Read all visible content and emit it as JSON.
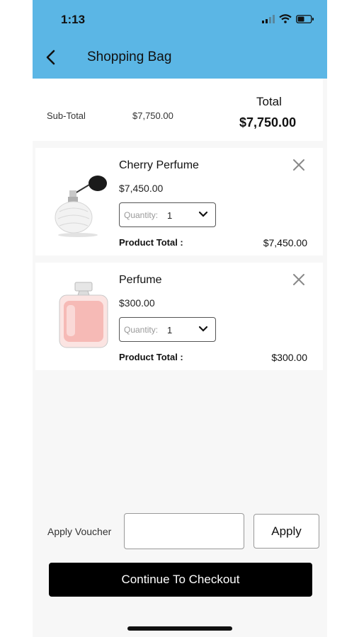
{
  "status_bar": {
    "time": "1:13"
  },
  "header": {
    "title": "Shopping Bag",
    "back_icon": "chevron-left-icon"
  },
  "summary": {
    "subtotal_label": "Sub-Total",
    "subtotal_value": "$7,750.00",
    "total_label": "Total",
    "total_value": "$7,750.00"
  },
  "items": [
    {
      "name": "Cherry Perfume",
      "price": "$7,450.00",
      "quantity_label": "Quantity:",
      "quantity_value": "1",
      "product_total_label": "Product Total :",
      "product_total_value": "$7,450.00"
    },
    {
      "name": "Perfume",
      "price": "$300.00",
      "quantity_label": "Quantity:",
      "quantity_value": "1",
      "product_total_label": "Product Total :",
      "product_total_value": "$300.00"
    }
  ],
  "voucher": {
    "label": "Apply Voucher",
    "value": "",
    "apply_label": "Apply"
  },
  "checkout": {
    "label": "Continue To Checkout"
  },
  "colors": {
    "header_bg": "#5bb6e5",
    "checkout_bg": "#000000"
  }
}
